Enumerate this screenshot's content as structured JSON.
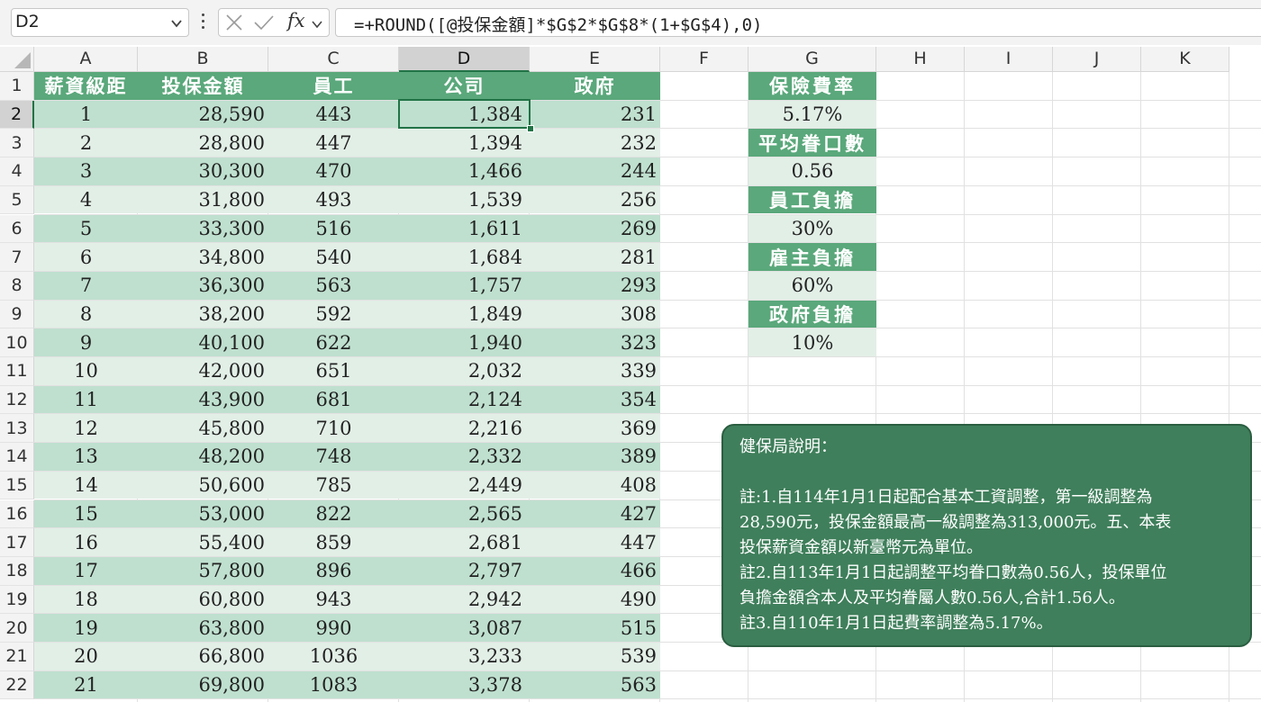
{
  "name_box": "D2",
  "formula_icons": {
    "cancel": "×",
    "enter": "✓",
    "fx": "fx"
  },
  "formula": "=+ROUND([@投保金額]*$G$2*$G$8*(1+$G$4),0)",
  "columns": [
    "A",
    "B",
    "C",
    "D",
    "E",
    "F",
    "G",
    "H",
    "I",
    "J",
    "K"
  ],
  "selected_column": "D",
  "selected_row": 2,
  "rows": [
    "1",
    "2",
    "3",
    "4",
    "5",
    "6",
    "7",
    "8",
    "9",
    "10",
    "11",
    "12",
    "13",
    "14",
    "15",
    "16",
    "17",
    "18",
    "19",
    "20",
    "21",
    "22"
  ],
  "table": {
    "headers": [
      "薪資級距",
      "投保金額",
      "員工",
      "公司",
      "政府"
    ],
    "rows": [
      [
        "1",
        "28,590",
        "443",
        "1,384",
        "231"
      ],
      [
        "2",
        "28,800",
        "447",
        "1,394",
        "232"
      ],
      [
        "3",
        "30,300",
        "470",
        "1,466",
        "244"
      ],
      [
        "4",
        "31,800",
        "493",
        "1,539",
        "256"
      ],
      [
        "5",
        "33,300",
        "516",
        "1,611",
        "269"
      ],
      [
        "6",
        "34,800",
        "540",
        "1,684",
        "281"
      ],
      [
        "7",
        "36,300",
        "563",
        "1,757",
        "293"
      ],
      [
        "8",
        "38,200",
        "592",
        "1,849",
        "308"
      ],
      [
        "9",
        "40,100",
        "622",
        "1,940",
        "323"
      ],
      [
        "10",
        "42,000",
        "651",
        "2,032",
        "339"
      ],
      [
        "11",
        "43,900",
        "681",
        "2,124",
        "354"
      ],
      [
        "12",
        "45,800",
        "710",
        "2,216",
        "369"
      ],
      [
        "13",
        "48,200",
        "748",
        "2,332",
        "389"
      ],
      [
        "14",
        "50,600",
        "785",
        "2,449",
        "408"
      ],
      [
        "15",
        "53,000",
        "822",
        "2,565",
        "427"
      ],
      [
        "16",
        "55,400",
        "859",
        "2,681",
        "447"
      ],
      [
        "17",
        "57,800",
        "896",
        "2,797",
        "466"
      ],
      [
        "18",
        "60,800",
        "943",
        "2,942",
        "490"
      ],
      [
        "19",
        "63,800",
        "990",
        "3,087",
        "515"
      ],
      [
        "20",
        "66,800",
        "1036",
        "3,233",
        "539"
      ],
      [
        "21",
        "69,800",
        "1083",
        "3,378",
        "563"
      ]
    ]
  },
  "params": [
    {
      "label": "保險費率",
      "value": "5.17%"
    },
    {
      "label": "平均眷口數",
      "value": "0.56"
    },
    {
      "label": "員工負擔",
      "value": "30%"
    },
    {
      "label": "雇主負擔",
      "value": "60%"
    },
    {
      "label": "政府負擔",
      "value": "10%"
    }
  ],
  "note": {
    "title": "健保局說明：",
    "lines": [
      "",
      "註:1.自114年1月1日起配合基本工資調整，第一級調整為",
      "28,590元，投保金額最高一級調整為313,000元。五、本表",
      "投保薪資金額以新臺幣元為單位。",
      "註2.自113年1月1日起調整平均眷口數為0.56人，投保單位",
      "負擔金額含本人及平均眷屬人數0.56人,合計1.56人。",
      "註3.自110年1月1日起費率調整為5.17%。"
    ]
  },
  "colors": {
    "header_green": "#5aa87b",
    "band_dark": "#bfe0cf",
    "band_light": "#e2efe7",
    "note_bg": "#3f7f5b",
    "select": "#217346"
  }
}
